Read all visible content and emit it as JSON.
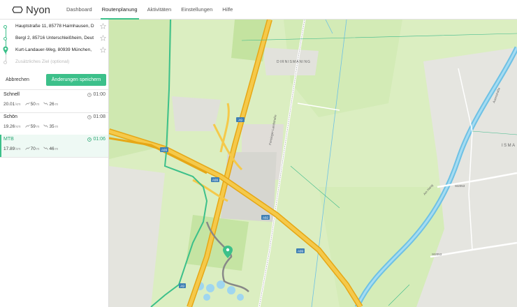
{
  "app": {
    "name": "Nyon"
  },
  "nav": [
    {
      "label": "Dashboard"
    },
    {
      "label": "Routenplanung"
    },
    {
      "label": "Aktivitäten"
    },
    {
      "label": "Einstellungen"
    },
    {
      "label": "Hilfe"
    }
  ],
  "waypoints": [
    {
      "address": "Hauptstraße 11, 85778 Haimhausen, D"
    },
    {
      "address": "Bergl 2, 85716 Unterschleißheim, Deut"
    },
    {
      "address": "Kurt-Landauer-Weg, 80939 München,"
    }
  ],
  "extra_destination": {
    "placeholder": "Zusätzliches Ziel (optional)"
  },
  "actions": {
    "cancel": "Abbrechen",
    "save": "Änderungen speichern"
  },
  "routes": [
    {
      "name": "Schnell",
      "time": "01:00",
      "distance": "20.01",
      "distance_unit": "km",
      "ascent": "50",
      "ascent_unit": "m",
      "descent": "26",
      "descent_unit": "m"
    },
    {
      "name": "Schön",
      "time": "01:08",
      "distance": "19.26",
      "distance_unit": "km",
      "ascent": "59",
      "ascent_unit": "m",
      "descent": "35",
      "descent_unit": "m"
    },
    {
      "name": "MTB",
      "time": "01:06",
      "distance": "17.89",
      "distance_unit": "km",
      "ascent": "70",
      "ascent_unit": "m",
      "descent": "46",
      "descent_unit": "m"
    }
  ],
  "map": {
    "labels": {
      "a99_1": "A99",
      "a99_2": "A99",
      "a92": "A92",
      "a9_1": "A9",
      "a9_2": "A9",
      "a9_3": "A9",
      "a99_3": "A99",
      "a99_4": "A99",
      "dirnismaning": "DIRNISMANING",
      "ismaning": "ISMA",
      "st2053_1": "St2053",
      "st2053_2": "St2053",
      "freisinger": "Freisinger Landstraße",
      "auenstrasse": "Auenstraße",
      "amhang": "Am Hang"
    }
  },
  "colors": {
    "accent": "#3cc08a",
    "motorway": "#f5b81f",
    "water": "#6ec1e4",
    "field": "#d9efb9"
  }
}
